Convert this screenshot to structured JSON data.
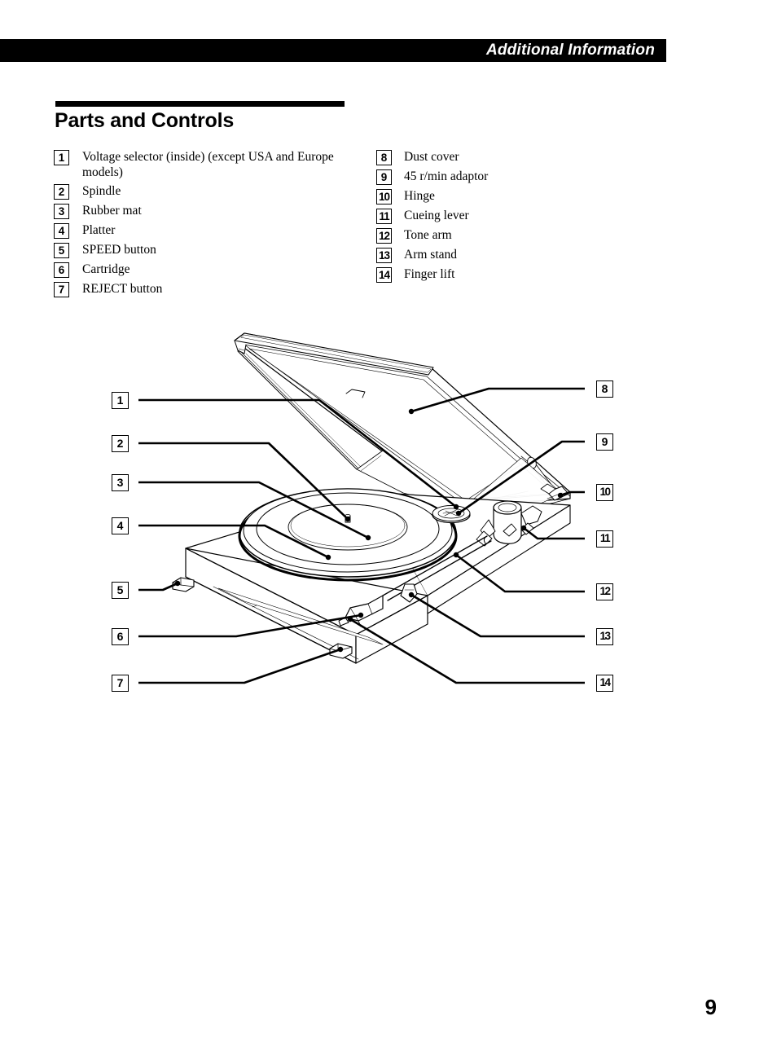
{
  "header": {
    "section_label": "Additional Information"
  },
  "title": "Parts and Controls",
  "legend": {
    "left_column": [
      {
        "num": "1",
        "label": "Voltage selector (inside) (except USA and Europe models)"
      },
      {
        "num": "2",
        "label": "Spindle"
      },
      {
        "num": "3",
        "label": "Rubber mat"
      },
      {
        "num": "4",
        "label": "Platter"
      },
      {
        "num": "5",
        "label": "SPEED button"
      },
      {
        "num": "6",
        "label": "Cartridge"
      },
      {
        "num": "7",
        "label": "REJECT button"
      }
    ],
    "right_column": [
      {
        "num": "8",
        "label": "Dust cover"
      },
      {
        "num": "9",
        "label": "45 r/min adaptor"
      },
      {
        "num": "10",
        "label": "Hinge"
      },
      {
        "num": "11",
        "label": "Cueing lever"
      },
      {
        "num": "12",
        "label": "Tone arm"
      },
      {
        "num": "13",
        "label": "Arm stand"
      },
      {
        "num": "14",
        "label": "Finger lift"
      }
    ]
  },
  "diagram": {
    "description": "Isometric line drawing of a turntable with open dust cover",
    "callouts_left": [
      {
        "num": "1"
      },
      {
        "num": "2"
      },
      {
        "num": "3"
      },
      {
        "num": "4"
      },
      {
        "num": "5"
      },
      {
        "num": "6"
      },
      {
        "num": "7"
      }
    ],
    "callouts_right": [
      {
        "num": "8"
      },
      {
        "num": "9"
      },
      {
        "num": "10"
      },
      {
        "num": "11"
      },
      {
        "num": "12"
      },
      {
        "num": "13"
      },
      {
        "num": "14"
      }
    ]
  },
  "page_number": "9",
  "colors": {
    "ink": "#000000",
    "paper": "#ffffff",
    "band_text": "#ffffff"
  }
}
